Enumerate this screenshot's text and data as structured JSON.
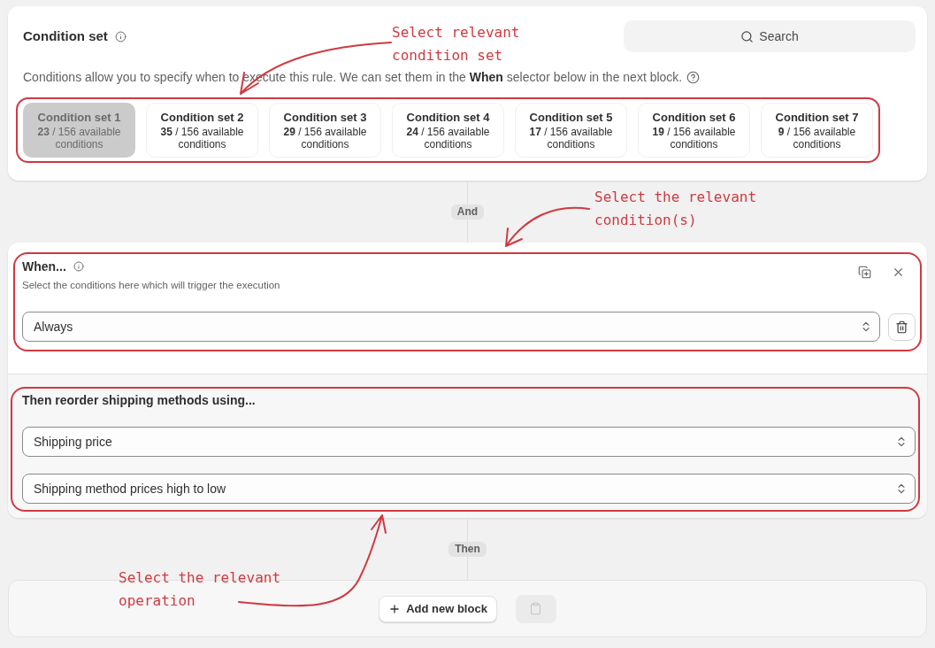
{
  "condition_set": {
    "title": "Condition set",
    "search_button": "Search",
    "description": "Conditions allow you to specify when to execute this rule. We can set them in the **When** selector below in the next block.",
    "sets": [
      {
        "name": "Condition set 1",
        "availability": "**23** / 156 available conditions",
        "selected": true
      },
      {
        "name": "Condition set 2",
        "availability": "**35** / 156 available conditions",
        "selected": false
      },
      {
        "name": "Condition set 3",
        "availability": "**29** / 156 available conditions",
        "selected": false
      },
      {
        "name": "Condition set 4",
        "availability": "**24** / 156 available conditions",
        "selected": false
      },
      {
        "name": "Condition set 5",
        "availability": "**17** / 156 available conditions",
        "selected": false
      },
      {
        "name": "Condition set 6",
        "availability": "**19** / 156 available conditions",
        "selected": false
      },
      {
        "name": "Condition set 7",
        "availability": "**9** / 156 available conditions",
        "selected": false
      }
    ]
  },
  "connector_and": "And",
  "when_block": {
    "title": "When...",
    "subtitle": "Select the conditions here which will trigger the execution",
    "select": {
      "value": "Always"
    }
  },
  "then_block": {
    "title": "Then reorder shipping methods using...",
    "selects": [
      {
        "value": "Shipping price"
      },
      {
        "value": "Shipping method prices high to low"
      }
    ]
  },
  "connector_then": "Then",
  "add_block": {
    "button": "Add new block",
    "paste_button": {
      "disabled": true
    }
  },
  "annotations": [
    {
      "text": "Select relevant condition set"
    },
    {
      "text": "Select the relevant condition(s)"
    },
    {
      "text": "Select the relevant operation"
    }
  ]
}
